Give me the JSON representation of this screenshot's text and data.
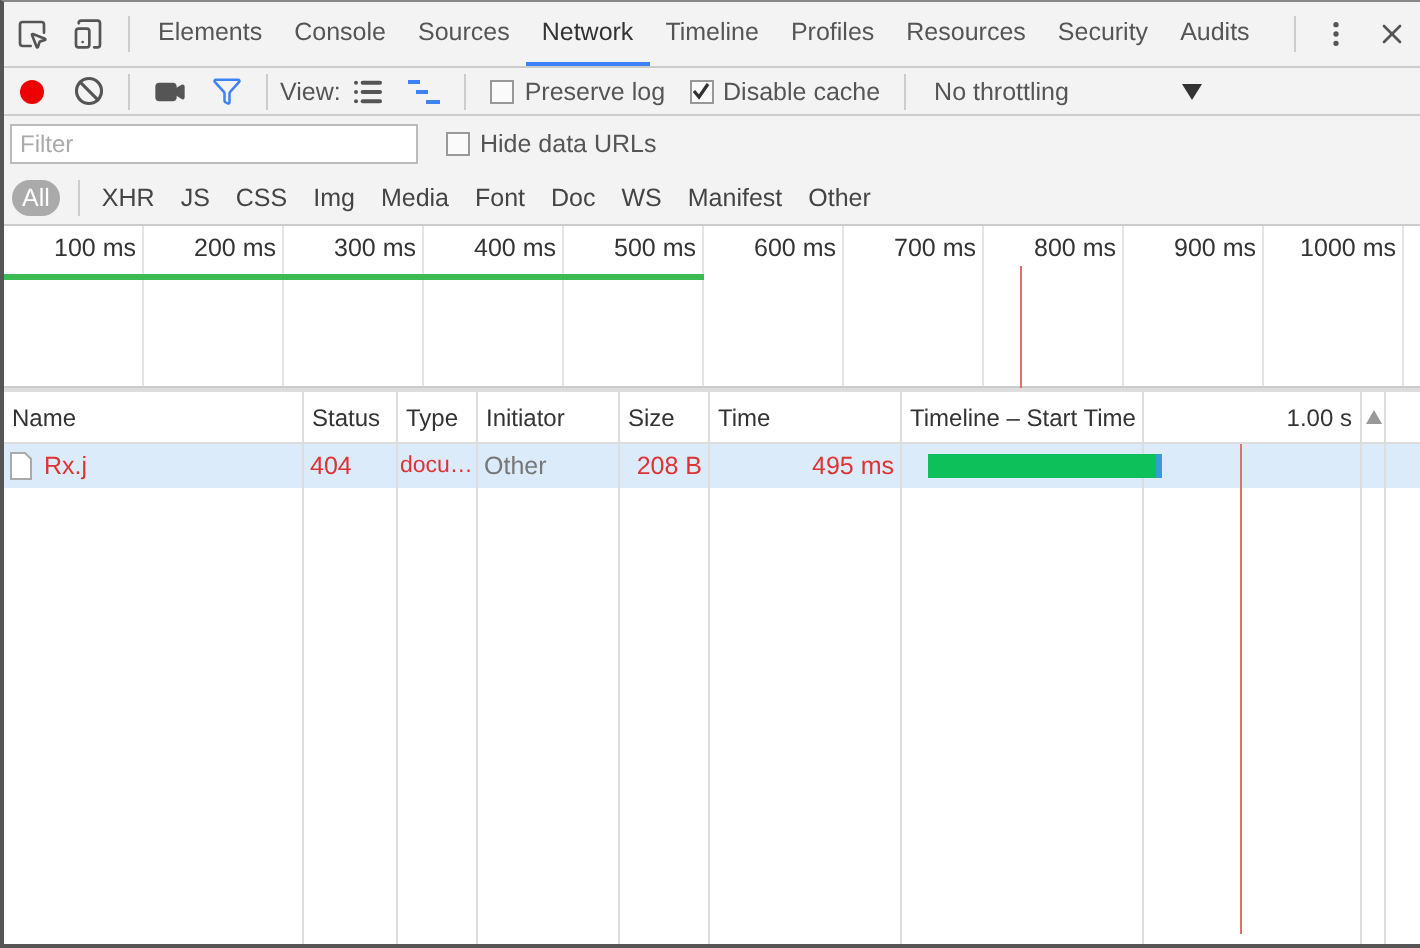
{
  "panel_tabs": [
    {
      "label": "Elements",
      "selected": false
    },
    {
      "label": "Console",
      "selected": false
    },
    {
      "label": "Sources",
      "selected": false
    },
    {
      "label": "Network",
      "selected": true
    },
    {
      "label": "Timeline",
      "selected": false
    },
    {
      "label": "Profiles",
      "selected": false
    },
    {
      "label": "Resources",
      "selected": false
    },
    {
      "label": "Security",
      "selected": false
    },
    {
      "label": "Audits",
      "selected": false
    }
  ],
  "toolbar": {
    "recording": true,
    "filter_active": true,
    "view_label": "View:",
    "view_modes": [
      {
        "kind": "list",
        "selected": false
      },
      {
        "kind": "waterfall",
        "selected": true
      }
    ],
    "checkboxes": [
      {
        "label": "Preserve log",
        "checked": false
      },
      {
        "label": "Disable cache",
        "checked": true
      }
    ],
    "throttling": "No throttling"
  },
  "filter": {
    "placeholder": "Filter",
    "hide_data_urls": {
      "label": "Hide data URLs",
      "checked": false
    }
  },
  "type_filters": [
    {
      "label": "All",
      "selected": true
    },
    {
      "label": "XHR",
      "selected": false
    },
    {
      "label": "JS",
      "selected": false
    },
    {
      "label": "CSS",
      "selected": false
    },
    {
      "label": "Img",
      "selected": false
    },
    {
      "label": "Media",
      "selected": false
    },
    {
      "label": "Font",
      "selected": false
    },
    {
      "label": "Doc",
      "selected": false
    },
    {
      "label": "WS",
      "selected": false
    },
    {
      "label": "Manifest",
      "selected": false
    },
    {
      "label": "Other",
      "selected": false
    }
  ],
  "overview": {
    "ticks": [
      "100 ms",
      "200 ms",
      "300 ms",
      "400 ms",
      "500 ms",
      "600 ms",
      "700 ms",
      "800 ms",
      "900 ms",
      "1000 ms"
    ]
  },
  "table": {
    "columns": [
      "Name",
      "Status",
      "Type",
      "Initiator",
      "Size",
      "Time",
      "Timeline – Start Time"
    ],
    "timeline_scale": "1.00 s",
    "rows": [
      {
        "name": "Rx.j",
        "status": "404",
        "type": "docu…",
        "initiator": "Other",
        "size": "208 B",
        "time": "495 ms",
        "failed": true,
        "selected": true
      }
    ]
  }
}
